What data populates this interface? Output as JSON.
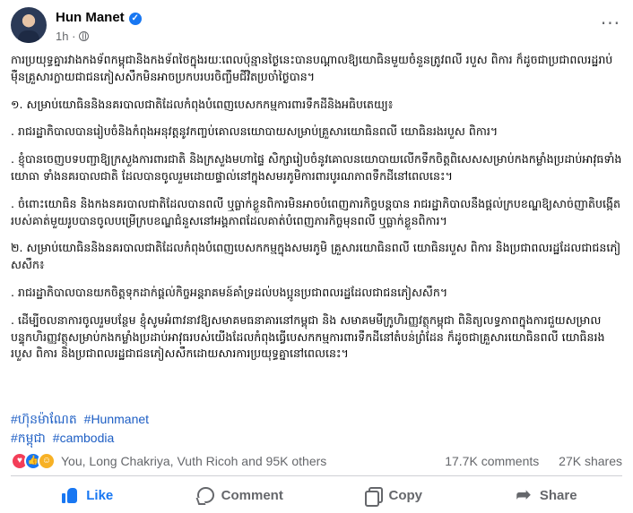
{
  "post": {
    "author": "Hun Manet",
    "time": "1h",
    "paragraphs": [
      "ការប្រយុទ្ធគ្នារវាងកងទ័ពកម្ពុជានិងកងទ័ពថៃក្នុងរយៈពេលប៉ុន្មានថ្ងៃនេះបានបណ្តាលឱ្យយោធិនមួយចំនួនត្រូវពលី របួស ពិការ ក៏ដូចជាប្រជាពលរដ្ឋរាប់ម៉ឺនគ្រួសារក្លាយជាជនភៀសសឹកមិនអាចប្រកបរបរចិញ្ចឹមជីវិតប្រចាំថ្ងៃបាន។",
      "១. សម្រាប់យោធិននិងនគរបាលជាតិដែលកំពុងបំពេញបេសកកម្មការពារទឹកដីនិងអធិបតេយ្យ៖",
      ". រាជរដ្ឋាភិបាលបានរៀបចំនិងកំពុងអនុវត្តនូវកញ្ចប់គោលនយោបាយសម្រាប់គ្រួសារយោធិនពលី យោធិនរងរបួស ពិការ។",
      ". ខ្ញុំបានចេញបទបញ្ជាឱ្យក្រសួងការពារជាតិ និងក្រសួងមហាផ្ទៃ សិក្សារៀបចំនូវគោលនយោបាយលើកទឹកចិត្តពិសេសសម្រាប់កងកម្លាំងប្រដាប់អាវុធទាំងយោធា ទាំងនគរបាលជាតិ ដែលបានចូលរួមដោយផ្ទាល់នៅក្នុងសមរភូមិការពារបូរណភាពទឹកដីនៅពេលនេះ។",
      ". ចំពោះយោធិន និងកងនគរបាលជាតិដែលបានពលី ឬធ្លាក់ខ្លួនពិការមិនអាចបំពេញភារកិច្ចបន្តបាន រាជរដ្ឋាភិបាលនឹងផ្តល់ក្របខណ្ឌឱ្យសាច់ញាតិបង្កើតរបស់គាត់មួយរូបបានចូលបម្រើក្របខណ្ឌជំនួសនៅអង្គភាពដែលគាត់បំពេញភារកិច្ចមុនពលី ឬធ្លាក់ខ្លួនពិការ។",
      "២. សម្រាប់យោធិននិងនគរបាលជាតិដែលកំពុងបំពេញបេសកកម្មក្នុងសមរភូមិ គ្រួសារយោធិនពលី យោធិនរបួស ពិការ និងប្រជាពលរដ្ឋដែលជាជនភៀសសឹក៖",
      ". រាជរដ្ឋាភិបាលបានយកចិត្តទុកដាក់ផ្តល់កិច្ចអន្តរាគមន៍គាំទ្រដល់បងប្អូនប្រជាពលរដ្ឋដែលជាជនភៀសសឹក។",
      ". ដើម្បីចលនាការចូលរួមបន្ថែម ខ្ញុំសូមអំពាវនាវឱ្យសមាគមធនាគារនៅកម្ពុជា និង សមាគមមីក្រូហិរញ្ញវត្ថុកម្ពុជា ពិនិត្យលទ្ធភាពក្នុងការជួយសម្រាលបន្ទុកហិរញ្ញវត្ថុសម្រាប់កងកម្លាំងប្រដាប់អាវុធរបស់យើងដែលកំពុងធ្វើបេសកកម្មការពារទឹកដីនៅតំបន់ព្រំដែន ក៏ដូចជាគ្រួសារយោធិនពលី យោធិនរងរបួស ពិការ និងប្រជាពលរដ្ឋជាជនភៀសសឹកដោយសារការប្រយុទ្ធគ្នានៅពេលនេះ។"
    ],
    "hashtags": [
      "#ហ៊ុនម៉ាណែត",
      "#Hunmanet",
      "#កម្ពុជា",
      "#cambodia"
    ]
  },
  "stats": {
    "reactors": "You, Long Chakriya, Vuth Ricoh and 95K others",
    "comments": "17.7K comments",
    "shares": "27K shares"
  },
  "actions": {
    "like": "Like",
    "comment": "Comment",
    "copy": "Copy",
    "share": "Share"
  },
  "colors": {
    "accent": "#1877f2",
    "hashtag": "#1d5ec4",
    "muted": "#65676b"
  }
}
